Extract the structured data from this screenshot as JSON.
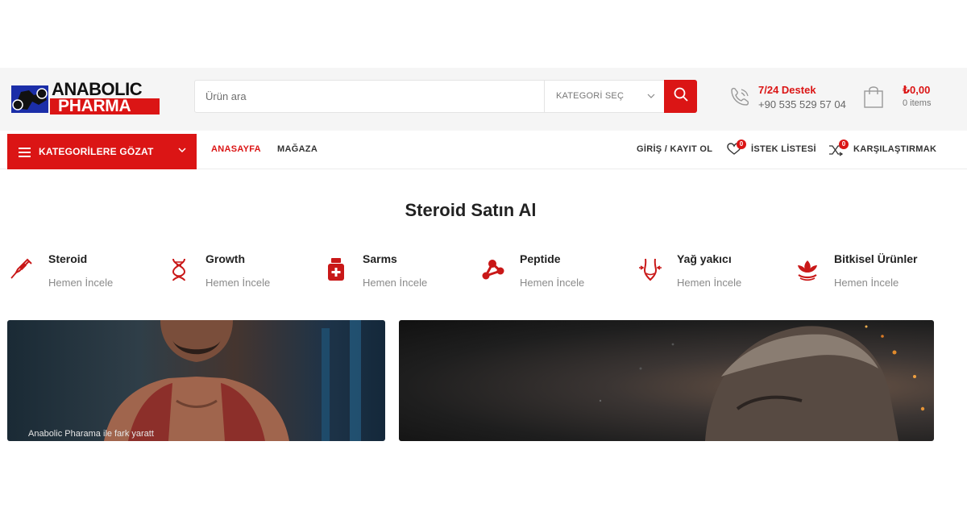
{
  "logo": {
    "line1": "ANABOLIC",
    "line2": "PHARMA"
  },
  "search": {
    "placeholder": "Ürün ara",
    "category_label": "KATEGORİ SEÇ"
  },
  "support": {
    "title": "7/24 Destek",
    "phone": "+90 535 529 57 04"
  },
  "cart": {
    "total": "₺0,00",
    "count_label": "0 items"
  },
  "nav": {
    "browse_label": "KATEGORİLERE GÖZAT",
    "links": [
      {
        "label": "ANASAYFA"
      },
      {
        "label": "MAĞAZA"
      }
    ],
    "login_label": "GİRİŞ / KAYIT OL",
    "wishlist_label": "İSTEK LİSTESİ",
    "wishlist_count": "0",
    "compare_label": "KARŞILAŞTIRMAK",
    "compare_count": "0"
  },
  "section_title": "Steroid Satın Al",
  "categories": [
    {
      "name": "Steroid",
      "sub": "Hemen İncele",
      "icon": "syringe-icon"
    },
    {
      "name": "Growth",
      "sub": "Hemen İncele",
      "icon": "dna-icon"
    },
    {
      "name": "Sarms",
      "sub": "Hemen İncele",
      "icon": "medicine-bottle-icon"
    },
    {
      "name": "Peptide",
      "sub": "Hemen İncele",
      "icon": "molecule-icon"
    },
    {
      "name": "Yağ yakıcı",
      "sub": "Hemen İncele",
      "icon": "waist-slimming-icon"
    },
    {
      "name": "Bitkisel Ürünler",
      "sub": "Hemen İncele",
      "icon": "herbal-icon"
    }
  ],
  "banners": [
    {
      "caption": "Anabolic Pharama ile fark yaratt"
    }
  ],
  "colors": {
    "accent": "#db1515",
    "header_bg": "#f5f5f5",
    "text": "#222222",
    "muted": "#8a8a8a"
  }
}
